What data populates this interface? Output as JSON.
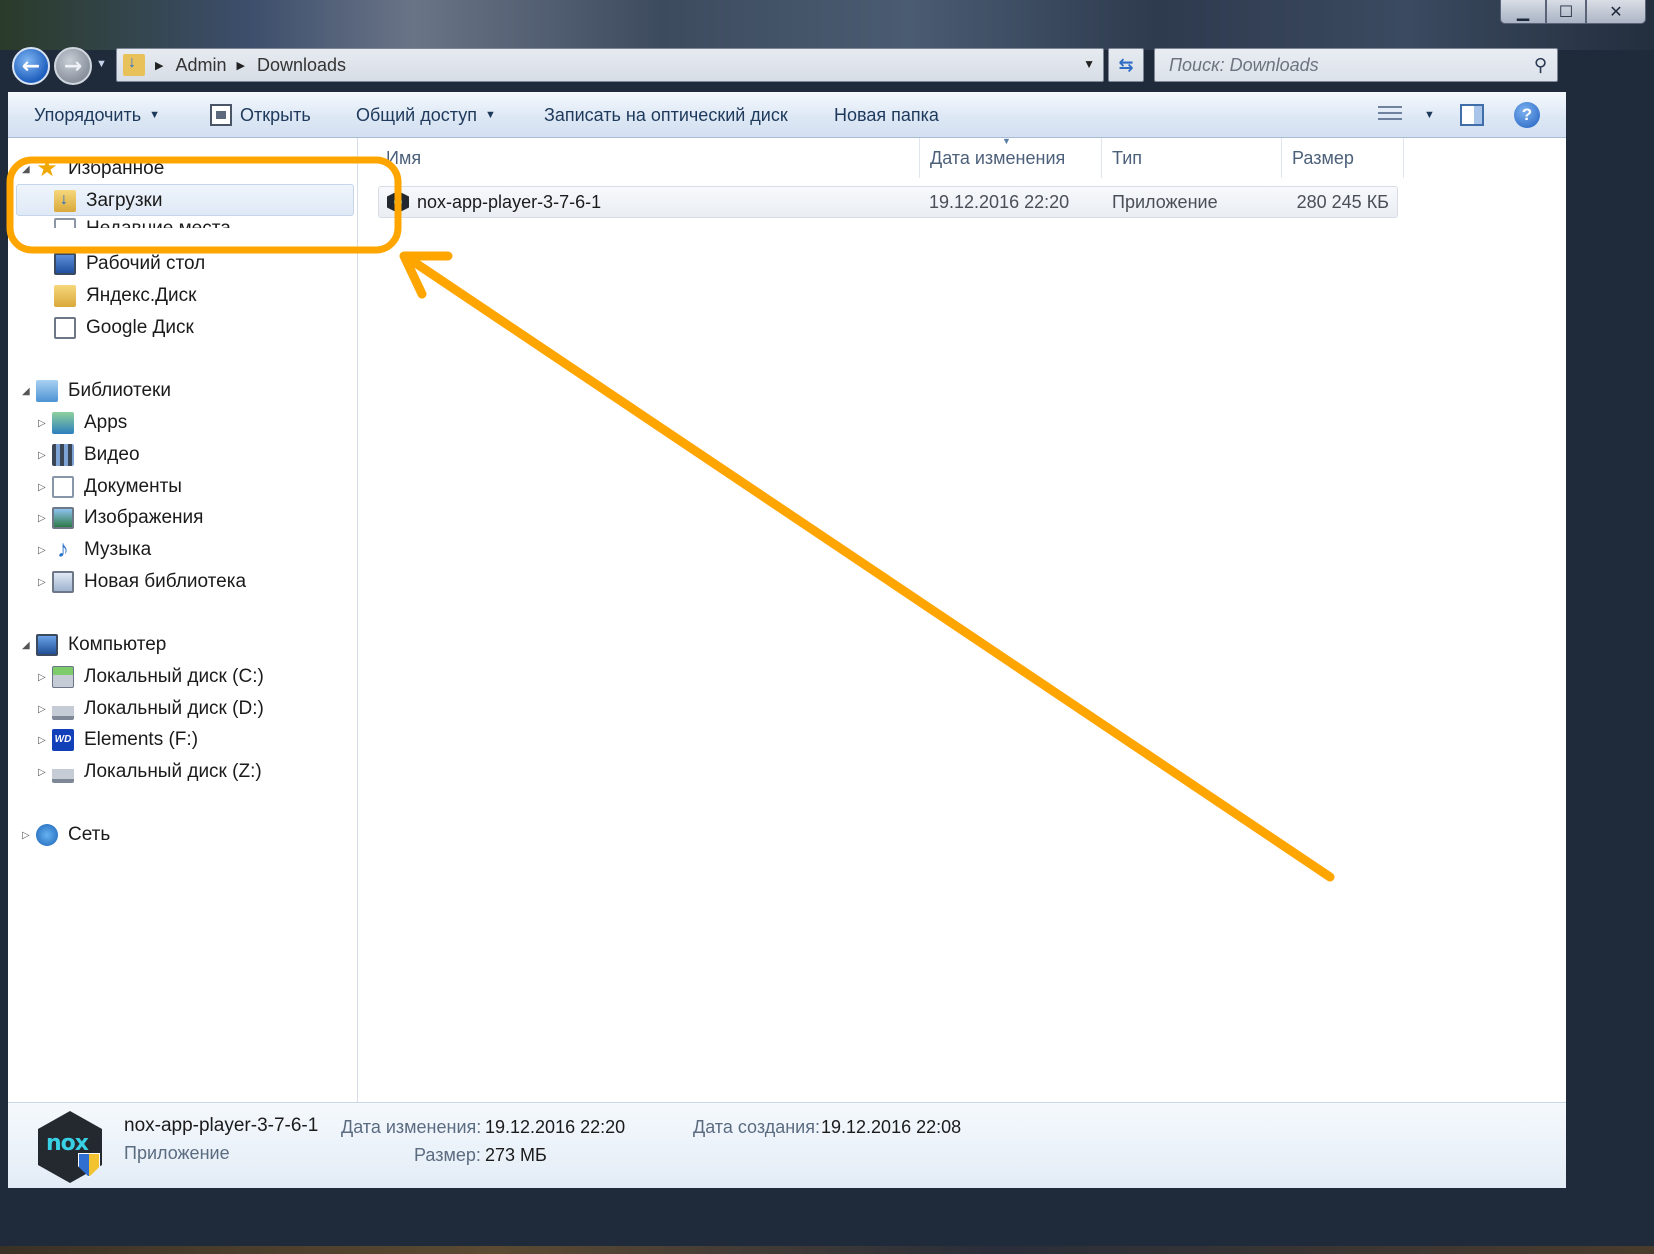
{
  "window": {
    "controls": {
      "minimize": "▁",
      "maximize": "☐",
      "close": "✕"
    }
  },
  "navbar": {
    "breadcrumbs": [
      "Admin",
      "Downloads"
    ],
    "search_placeholder": "Поиск: Downloads"
  },
  "toolbar": {
    "organize": "Упорядочить",
    "open": "Открыть",
    "share": "Общий доступ",
    "burn": "Записать на оптический диск",
    "new_folder": "Новая папка"
  },
  "navpane": {
    "favorites": {
      "label": "Избранное",
      "items": [
        "Загрузки",
        "Недавние места",
        "Рабочий стол",
        "Яндекс.Диск",
        "Google Диск"
      ]
    },
    "libraries": {
      "label": "Библиотеки",
      "items": [
        "Apps",
        "Видео",
        "Документы",
        "Изображения",
        "Музыка",
        "Новая библиотека"
      ]
    },
    "computer": {
      "label": "Компьютер",
      "items": [
        "Локальный диск (C:)",
        "Локальный диск (D:)",
        "Elements (F:)",
        "Локальный диск (Z:)"
      ],
      "wd_badge": "WD"
    },
    "network": {
      "label": "Сеть"
    }
  },
  "columns": {
    "name": "Имя",
    "date": "Дата изменения",
    "type": "Тип",
    "size": "Размер"
  },
  "files": [
    {
      "name": "nox-app-player-3-7-6-1",
      "date": "19.12.2016 22:20",
      "type": "Приложение",
      "size": "280 245 КБ"
    }
  ],
  "details": {
    "name": "nox-app-player-3-7-6-1",
    "type": "Приложение",
    "icon_text": "nox",
    "modified_label": "Дата изменения:",
    "modified_value": "19.12.2016 22:20",
    "created_label": "Дата создания:",
    "created_value": "19.12.2016 22:08",
    "size_label": "Размер:",
    "size_value": "273 МБ"
  },
  "annotation": {
    "color": "#FFA500"
  },
  "colors": {
    "toolbar_text": "#1e395b",
    "header_text": "#4c607a",
    "accent": "#1f5fbe"
  }
}
